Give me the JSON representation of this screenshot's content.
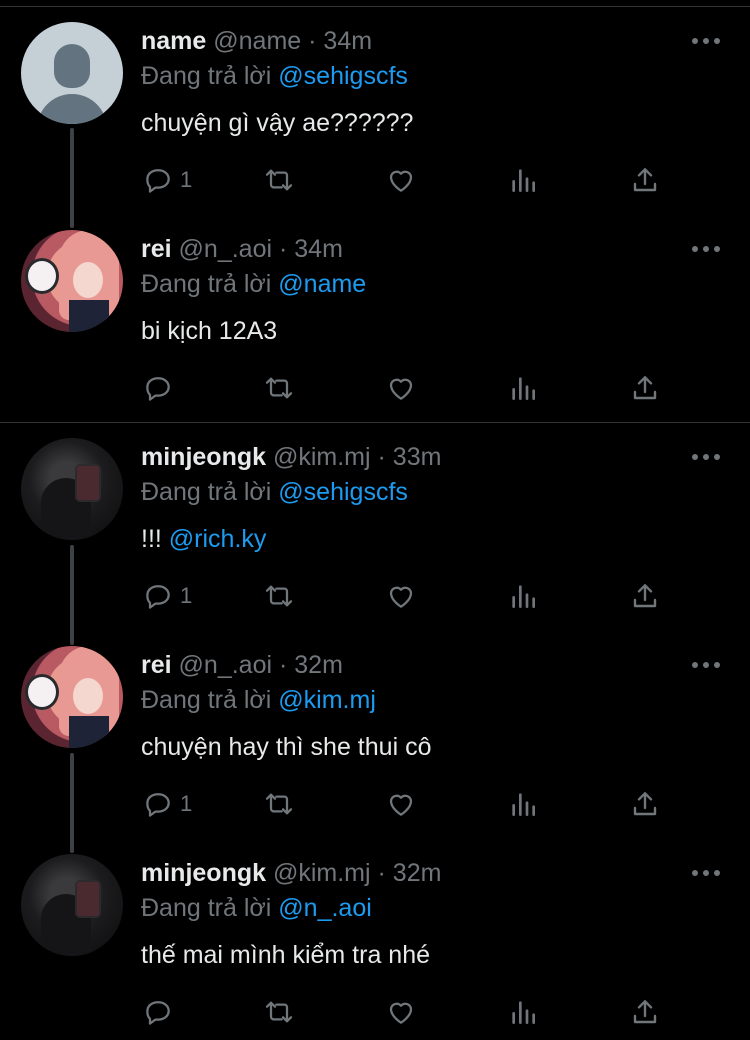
{
  "tweets": [
    {
      "name": "name",
      "handle": "@name",
      "time": "34m",
      "reply_prefix": "Đang trả lời",
      "reply_to": "@sehigscfs",
      "text": "chuyện gì vậy ae??????",
      "mention": "",
      "reply_count": "1",
      "avatar": "default-avatar"
    },
    {
      "name": "rei",
      "handle": "@n_.aoi",
      "time": "34m",
      "reply_prefix": "Đang trả lời",
      "reply_to": "@name",
      "text": "bi kịch 12A3",
      "mention": "",
      "reply_count": "",
      "avatar": "rei-avatar"
    },
    {
      "name": "minjeongk",
      "handle": "@kim.mj",
      "time": "33m",
      "reply_prefix": "Đang trả lời",
      "reply_to": "@sehigscfs",
      "text": "!!! ",
      "mention": "@rich.ky",
      "reply_count": "1",
      "avatar": "minjeongk-avatar"
    },
    {
      "name": "rei",
      "handle": "@n_.aoi",
      "time": "32m",
      "reply_prefix": "Đang trả lời",
      "reply_to": "@kim.mj",
      "text": "chuyện hay thì she thui cô",
      "mention": "",
      "reply_count": "1",
      "avatar": "rei-avatar"
    },
    {
      "name": "minjeongk",
      "handle": "@kim.mj",
      "time": "32m",
      "reply_prefix": "Đang trả lời",
      "reply_to": "@n_.aoi",
      "text": "thế mai mình kiểm tra nhé",
      "mention": "",
      "reply_count": "",
      "avatar": "minjeongk-avatar"
    }
  ],
  "separator": "·",
  "icons": [
    "reply-icon",
    "retweet-icon",
    "like-icon",
    "analytics-icon",
    "share-icon",
    "more-icon"
  ],
  "colors": {
    "background": "#000000",
    "text": "#e7e9ea",
    "secondary": "#71767b",
    "mention": "#1d9bf0",
    "divider": "#2f3336"
  }
}
